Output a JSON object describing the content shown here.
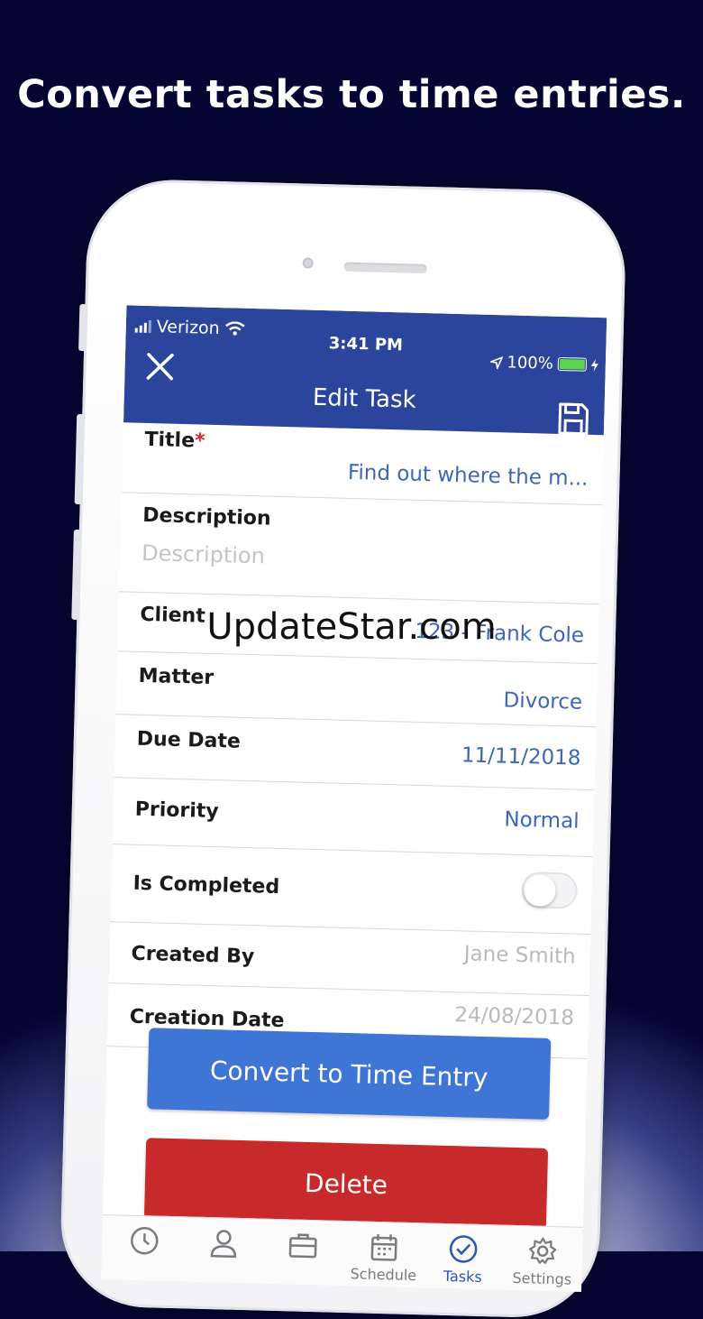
{
  "headline": "Convert tasks to time entries.",
  "status_bar": {
    "carrier": "Verizon",
    "time": "3:41 PM",
    "battery": "100%"
  },
  "nav": {
    "title": "Edit Task"
  },
  "form": {
    "title_label": "Title",
    "title_required": "*",
    "title_value": "Find out where the m...",
    "description_label": "Description",
    "description_placeholder": "Description",
    "client_label": "Client",
    "client_value": "123 - Frank Cole",
    "matter_label": "Matter",
    "matter_value": "Divorce",
    "due_date_label": "Due Date",
    "due_date_value": "11/11/2018",
    "priority_label": "Priority",
    "priority_value": "Normal",
    "completed_label": "Is Completed",
    "completed": false,
    "created_by_label": "Created By",
    "created_by_value": "Jane Smith",
    "creation_date_label": "Creation Date",
    "creation_date_value": "24/08/2018"
  },
  "buttons": {
    "convert": "Convert to Time Entry",
    "delete": "Delete"
  },
  "tabbar": {
    "items": [
      {
        "icon": "clock-icon",
        "label": ""
      },
      {
        "icon": "person-icon",
        "label": ""
      },
      {
        "icon": "briefcase-icon",
        "label": ""
      },
      {
        "icon": "calendar-icon",
        "label": "Schedule"
      },
      {
        "icon": "check-circle-icon",
        "label": "Tasks",
        "active": true
      },
      {
        "icon": "gear-icon",
        "label": "Settings"
      }
    ]
  },
  "colors": {
    "nav": "#2c459c",
    "accent": "#3f75d5",
    "danger": "#c8292a",
    "value": "#3e66b6"
  },
  "watermark": "UpdateStar.com"
}
